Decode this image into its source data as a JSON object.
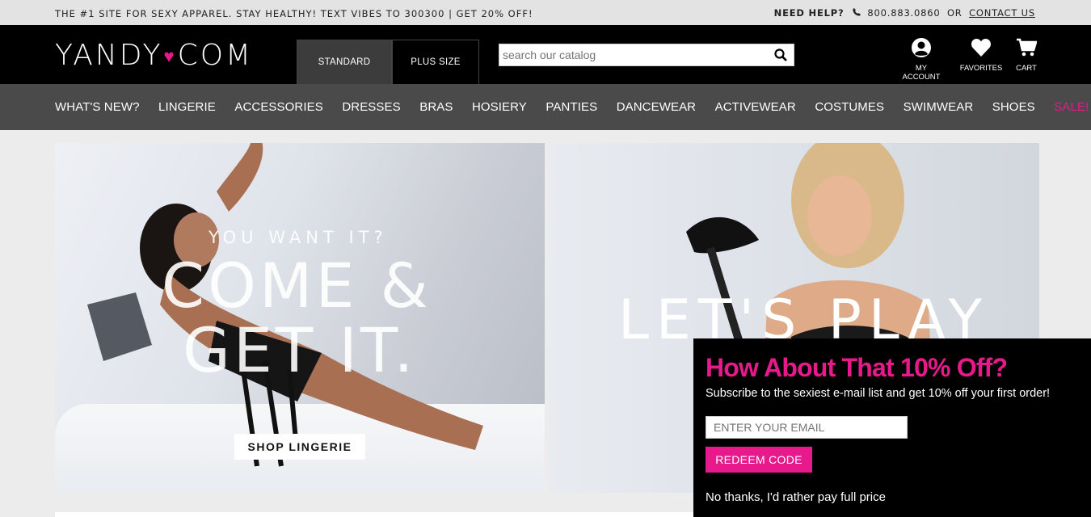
{
  "topbar": {
    "promo": "THE #1 SITE FOR SEXY APPAREL. STAY HEALTHY! TEXT VIBES TO 300300 | GET 20% OFF!",
    "need_help": "NEED HELP?",
    "phone": "800.883.0860",
    "or": "OR",
    "contact": "CONTACT US"
  },
  "header": {
    "logo_left": "YANDY",
    "logo_right": "COM",
    "tabs": [
      "STANDARD",
      "PLUS SIZE"
    ],
    "search_placeholder": "search our catalog",
    "account": "MY ACCOUNT",
    "favorites": "FAVORITES",
    "cart": "CART"
  },
  "nav": [
    "WHAT'S NEW?",
    "LINGERIE",
    "ACCESSORIES",
    "DRESSES",
    "BRAS",
    "HOSIERY",
    "PANTIES",
    "DANCEWEAR",
    "ACTIVEWEAR",
    "COSTUMES",
    "SWIMWEAR",
    "SHOES",
    "SALE!"
  ],
  "hero_left": {
    "kicker": "YOU WANT IT?",
    "line1": "COME &",
    "line2": "GET IT.",
    "button": "SHOP LINGERIE"
  },
  "hero_right": {
    "headline": "LET'S PLAY"
  },
  "popup": {
    "title": "How About That 10% Off?",
    "subtitle": "Subscribe to the sexiest e-mail list and get 10% off your first order!",
    "email_placeholder": "ENTER YOUR EMAIL",
    "redeem": "REDEEM CODE",
    "no_thanks": "No thanks, I'd rather pay full price"
  },
  "colors": {
    "brand_pink": "#e8198b",
    "header_black": "#000000",
    "nav_gray": "#4a4a4a"
  }
}
